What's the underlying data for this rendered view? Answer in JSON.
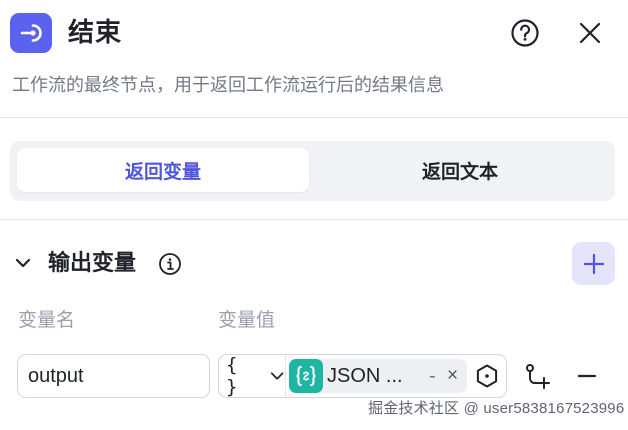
{
  "header": {
    "icon": "end-node-icon",
    "title": "结束",
    "help_icon": "question-circle-icon",
    "close_icon": "close-icon",
    "description": "工作流的最终节点，用于返回工作流运行后的结果信息"
  },
  "tabs": [
    {
      "label": "返回变量",
      "active": true
    },
    {
      "label": "返回文本",
      "active": false
    }
  ],
  "output_section": {
    "title": "输出变量",
    "info_icon": "info-circle-icon",
    "add_icon": "plus-icon",
    "columns": {
      "name": "变量名",
      "value": "变量值"
    },
    "rows": [
      {
        "name": "output",
        "type_glyph": "{ }",
        "reference_label": "JSON ...",
        "reference_dash": "-",
        "reference_clear": "×",
        "badge_icon": "json-variable-icon"
      }
    ]
  },
  "colors": {
    "accent": "#5c62f0",
    "tab_active_text": "#4e55e0",
    "json_badge": "#1fb5a3",
    "add_button_bg": "#e4e5fb"
  },
  "watermark": "掘金技术社区 @ user5838167523996"
}
